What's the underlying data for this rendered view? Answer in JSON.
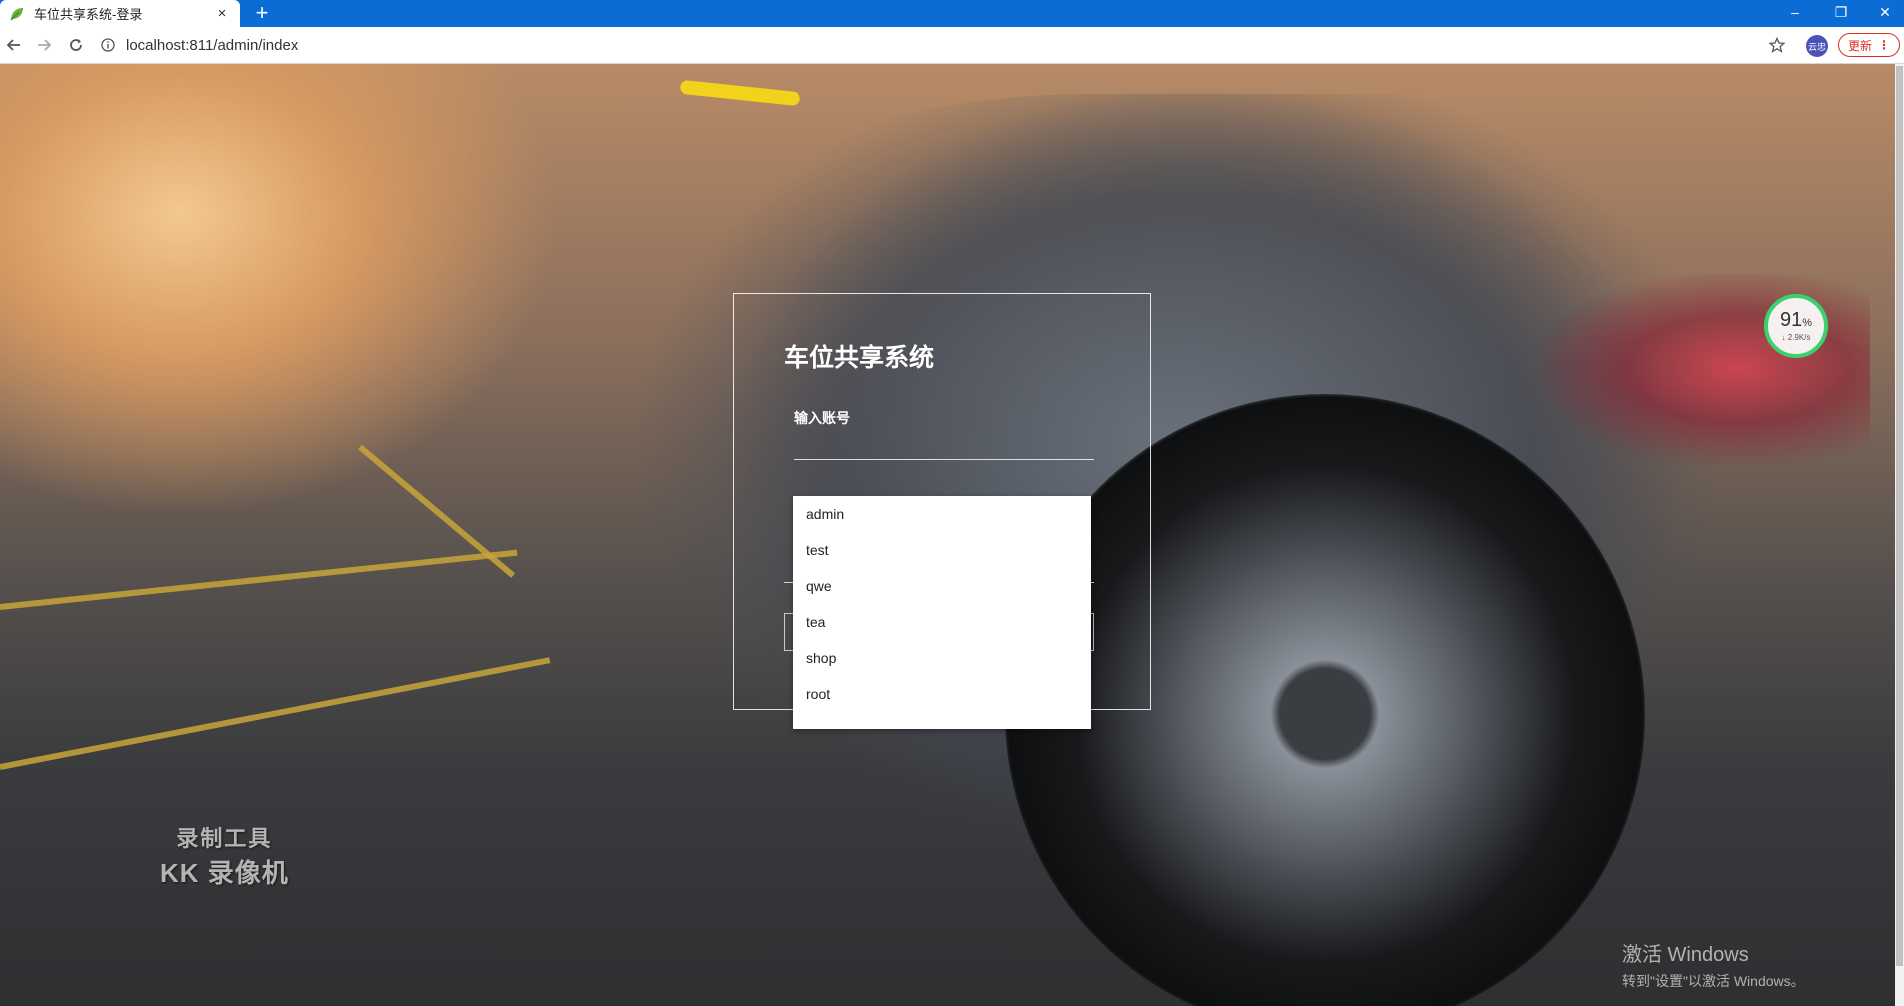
{
  "browser": {
    "tab_title": "车位共享系统-登录",
    "new_tab_label": "+",
    "url": "localhost:811/admin/index",
    "avatar_label": "云忠",
    "update_label": "更新",
    "update_menu": "⋮",
    "window_controls": {
      "minimize": "–",
      "restore": "❐",
      "close": "✕"
    },
    "tab_close": "×"
  },
  "login": {
    "title": "车位共享系统",
    "account_label": "输入账号"
  },
  "autocomplete": {
    "items": [
      "admin",
      "test",
      "qwe",
      "tea",
      "shop",
      "root"
    ]
  },
  "speed_widget": {
    "percent": "91",
    "percent_sign": "%",
    "rate": "↓ 2.9K/s"
  },
  "watermark": {
    "line1": "录制工具",
    "line2": "KK 录像机"
  },
  "activation": {
    "title": "激活 Windows",
    "subtitle": "转到\"设置\"以激活 Windows。"
  },
  "colors": {
    "tab_bar": "#0a6cd4",
    "update_red": "#d93025",
    "speed_ring": "#3bd16f"
  }
}
